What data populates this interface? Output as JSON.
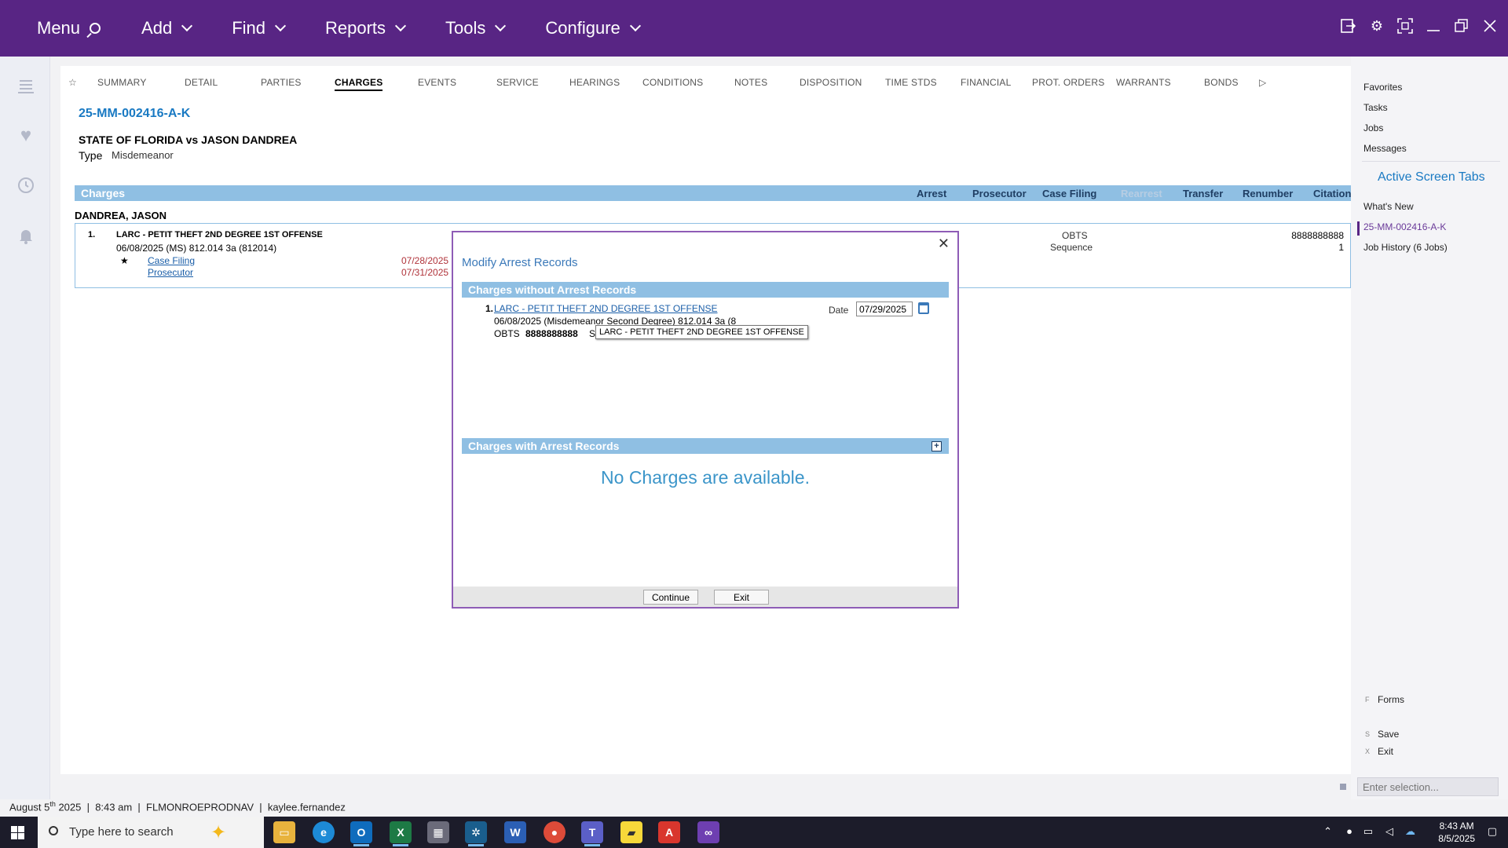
{
  "topbar": {
    "menu": [
      {
        "label": "Menu",
        "icon": "search-icon"
      },
      {
        "label": "Add",
        "icon": "chevron-down-icon"
      },
      {
        "label": "Find",
        "icon": "chevron-down-icon"
      },
      {
        "label": "Reports",
        "icon": "chevron-down-icon"
      },
      {
        "label": "Tools",
        "icon": "chevron-down-icon"
      },
      {
        "label": "Configure",
        "icon": "chevron-down-icon"
      }
    ],
    "icons": [
      "sign-out-icon",
      "gear-icon",
      "fullscreen-icon",
      "minimize-icon",
      "restore-icon",
      "close-icon"
    ]
  },
  "tabs": [
    "SUMMARY",
    "DETAIL",
    "PARTIES",
    "CHARGES",
    "EVENTS",
    "SERVICE",
    "HEARINGS",
    "CONDITIONS",
    "NOTES",
    "DISPOSITION",
    "TIME STDS",
    "FINANCIAL",
    "PROT. ORDERS",
    "WARRANTS",
    "BONDS"
  ],
  "active_tab": "CHARGES",
  "case": {
    "number": "25-MM-002416-A-K",
    "title": "STATE OF FLORIDA vs JASON DANDREA",
    "type_label": "Type",
    "type_value": "Misdemeanor"
  },
  "charges_section": {
    "title": "Charges",
    "actions": [
      {
        "label": "Arrest",
        "enabled": true
      },
      {
        "label": "Prosecutor",
        "enabled": true
      },
      {
        "label": "Case Filing",
        "enabled": true
      },
      {
        "label": "Rearrest",
        "enabled": false
      },
      {
        "label": "Transfer",
        "enabled": true
      },
      {
        "label": "Renumber",
        "enabled": true
      },
      {
        "label": "Citation",
        "enabled": true
      }
    ],
    "defendant": "DANDREA, JASON",
    "charge": {
      "number": "1.",
      "title": "LARC - PETIT THEFT 2ND DEGREE 1ST OFFENSE",
      "line2": "06/08/2025  (MS) 812.014 3a (812014)",
      "star": "★",
      "links": [
        {
          "label": "Case Filing",
          "date": "07/28/2025"
        },
        {
          "label": "Prosecutor",
          "date": "07/31/2025"
        }
      ],
      "obts_label": "OBTS",
      "obts_value": "8888888888",
      "sequence_label": "Sequence",
      "sequence_value": "1"
    }
  },
  "sidebar": {
    "items": [
      "Favorites",
      "Tasks",
      "Jobs",
      "Messages"
    ],
    "heading": "Active Screen Tabs",
    "screen_tabs": [
      "What's New",
      "25-MM-002416-A-K",
      "Job History (6 Jobs)"
    ],
    "actions": [
      {
        "key": "F",
        "label": "Forms"
      },
      {
        "key": "S",
        "label": "Save"
      },
      {
        "key": "X",
        "label": "Exit"
      }
    ],
    "enter_placeholder": "Enter selection..."
  },
  "status": {
    "date_prefix": "August 5",
    "date_sup": "th",
    "date_rest": " 2025  |  8:43 am  |  FLMONROEPRODNAV  |  kaylee.fernandez"
  },
  "modal": {
    "title": "Modify Arrest Records",
    "section_without": "Charges without Arrest Records",
    "section_with": "Charges with Arrest Records",
    "charge_number": "1.",
    "charge_link": "LARC - PETIT THEFT 2ND DEGREE 1ST OFFENSE",
    "charge_line2": "06/08/2025  (Misdemeanor Second Degree) 812.014 3a (8",
    "obts_label": "OBTS",
    "obts_value": "8888888888",
    "seq_fragment": "S",
    "date_label": "Date",
    "date_value": "07/29/2025",
    "tooltip": "LARC - PETIT THEFT 2ND DEGREE 1ST OFFENSE",
    "empty_message": "No Charges are available.",
    "continue_label": "Continue",
    "exit_label": "Exit"
  },
  "taskbar": {
    "search_placeholder": "Type here to search",
    "apps": [
      "file-explorer-icon",
      "edge-icon",
      "outlook-icon",
      "excel-icon",
      "calculator-icon",
      "app-icon",
      "word-icon",
      "chrome-icon",
      "teams-icon",
      "sticky-notes-icon",
      "acrobat-icon",
      "visual-studio-icon"
    ],
    "time": "8:43 AM",
    "date": "8/5/2025"
  }
}
